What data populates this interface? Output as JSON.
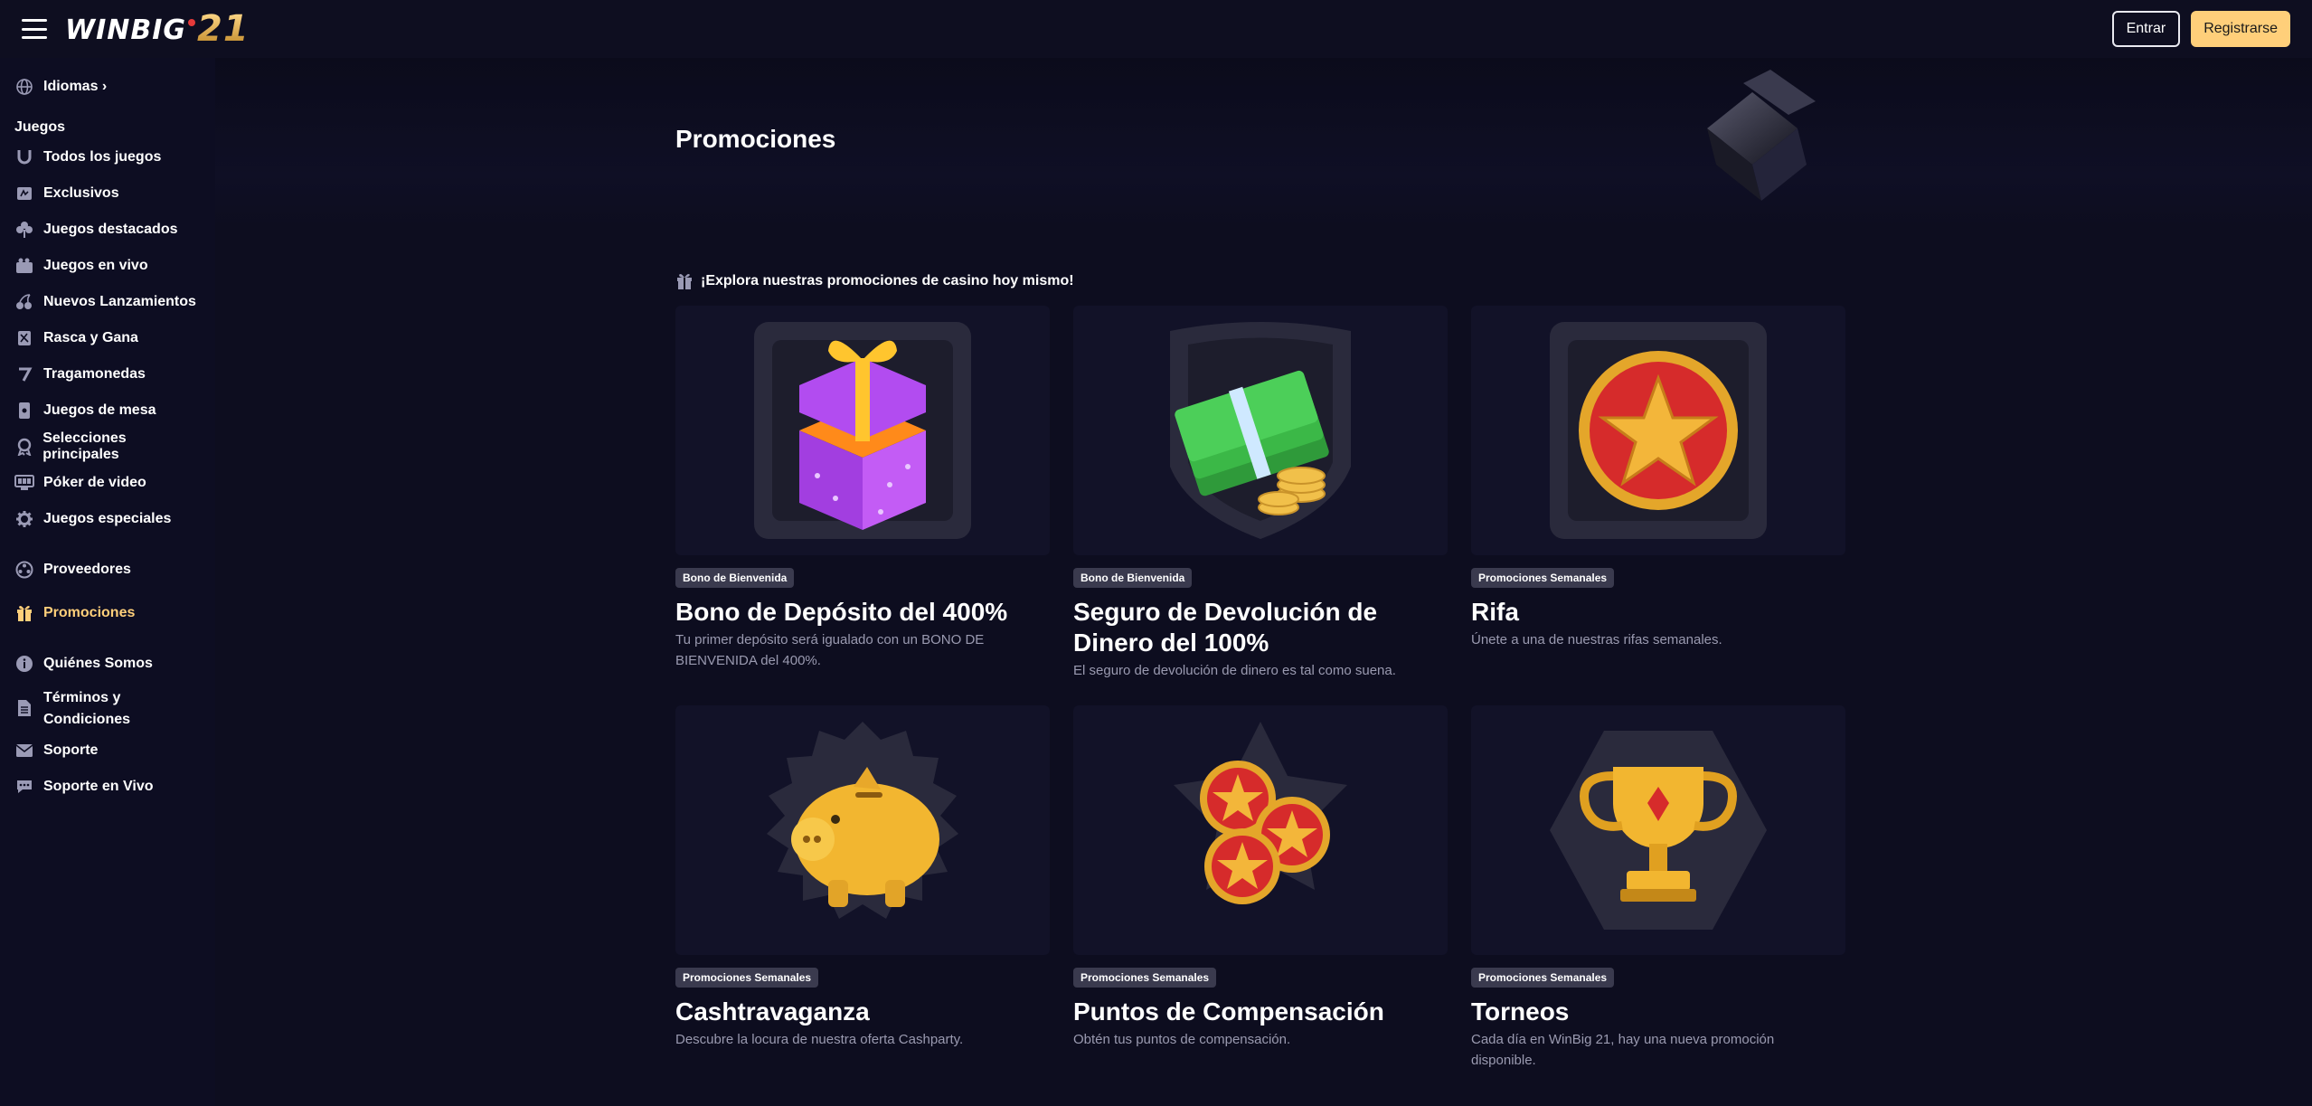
{
  "header": {
    "logo_text": "WINBIG",
    "logo_number": "21",
    "login_label": "Entrar",
    "register_label": "Registrarse"
  },
  "sidebar": {
    "languages": "Idiomas ›",
    "section_games": "Juegos",
    "items": [
      {
        "label": "Todos los juegos",
        "icon": "horseshoe-icon"
      },
      {
        "label": "Exclusivos",
        "icon": "exclusive-icon"
      },
      {
        "label": "Juegos destacados",
        "icon": "clover-icon"
      },
      {
        "label": "Juegos en vivo",
        "icon": "live-icon"
      },
      {
        "label": "Nuevos Lanzamientos",
        "icon": "cherries-icon"
      },
      {
        "label": "Rasca y Gana",
        "icon": "scratch-icon"
      },
      {
        "label": "Tragamonedas",
        "icon": "seven-icon"
      },
      {
        "label": "Juegos de mesa",
        "icon": "cards-icon"
      },
      {
        "label": "Selecciones principales",
        "icon": "award-icon"
      },
      {
        "label": "Póker de video",
        "icon": "video-poker-icon"
      },
      {
        "label": "Juegos especiales",
        "icon": "gear-icon"
      }
    ],
    "providers": "Proveedores",
    "promotions": "Promociones",
    "about": "Quiénes Somos",
    "terms": "Términos y Condiciones",
    "support": "Soporte",
    "live_support": "Soporte en Vivo",
    "active_color": "#ffcf7a"
  },
  "main": {
    "title": "Promociones",
    "explore_text": "¡Explora nuestras promociones de casino hoy mismo!",
    "cards": [
      {
        "badge": "Bono de Bienvenida",
        "title": "Bono de Depósito del 400%",
        "desc": "Tu primer depósito será igualado con un BONO DE BIENVENIDA del 400%.",
        "icon": "gift-box-icon"
      },
      {
        "badge": "Bono de Bienvenida",
        "title": "Seguro de Devolución de Dinero del 100%",
        "desc": "El seguro de devolución de dinero es tal como suena.",
        "icon": "money-stack-icon"
      },
      {
        "badge": "Promociones Semanales",
        "title": "Rifa",
        "desc": "Únete a una de nuestras rifas semanales.",
        "icon": "star-coin-icon"
      },
      {
        "badge": "Promociones Semanales",
        "title": "Cashtravaganza",
        "desc": "Descubre la locura de nuestra oferta Cashparty.",
        "icon": "piggy-bank-icon"
      },
      {
        "badge": "Promociones Semanales",
        "title": "Puntos de Compensación",
        "desc": "Obtén tus puntos de compensación.",
        "icon": "star-coins-icon"
      },
      {
        "badge": "Promociones Semanales",
        "title": "Torneos",
        "desc": "Cada día en WinBig 21, hay una nueva promoción disponible.",
        "icon": "trophy-icon"
      }
    ]
  }
}
